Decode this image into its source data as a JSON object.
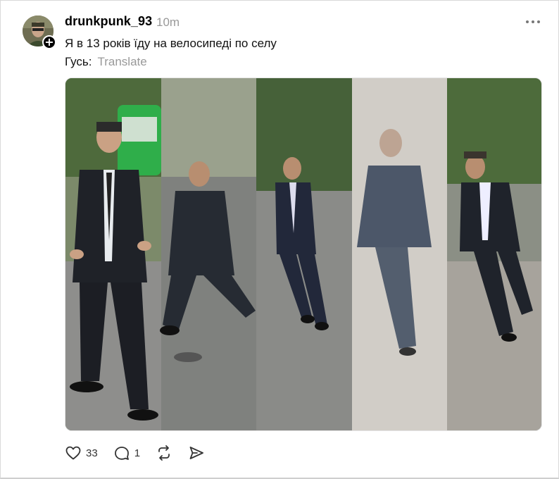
{
  "post": {
    "username": "drunkpunk_93",
    "time": "10m",
    "text": "Я в 13 років їду на велосипеді по селу",
    "caption_prefix": "Гусь:",
    "translate_label": "Translate"
  },
  "actions": {
    "like_count": "33",
    "reply_count": "1"
  },
  "icons": {
    "more": "more-horizontal-icon",
    "like": "heart-icon",
    "reply": "comment-icon",
    "repost": "repost-icon",
    "share": "send-icon"
  },
  "colors": {
    "text": "#000000",
    "muted": "#999999",
    "border": "#d9d9d9"
  }
}
